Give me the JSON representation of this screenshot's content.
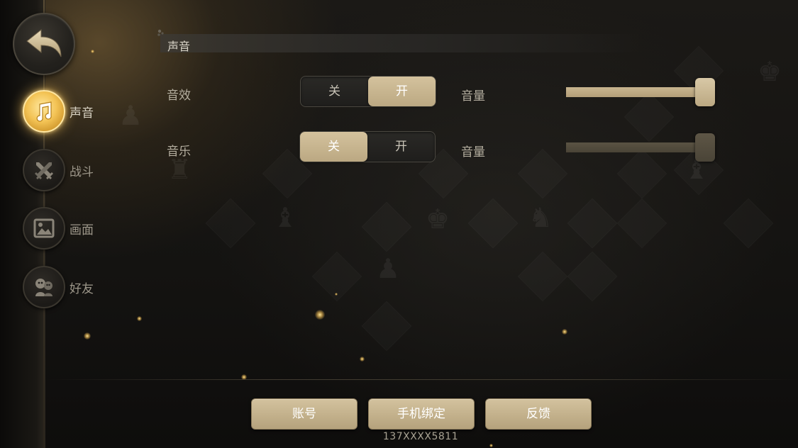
{
  "nav": {
    "back_icon": "back-arrow-icon",
    "items": [
      {
        "label": "声音",
        "icon": "music-note-icon",
        "active": true
      },
      {
        "label": "战斗",
        "icon": "crossed-swords-icon",
        "active": false
      },
      {
        "label": "画面",
        "icon": "picture-icon",
        "active": false
      },
      {
        "label": "好友",
        "icon": "friends-icon",
        "active": false
      }
    ]
  },
  "section": {
    "title": "声音"
  },
  "settings": [
    {
      "label": "音效",
      "toggle_off_label": "关",
      "toggle_on_label": "开",
      "state": "开",
      "volume_label": "音量",
      "volume": 1.0
    },
    {
      "label": "音乐",
      "toggle_off_label": "关",
      "toggle_on_label": "开",
      "state": "关",
      "volume_label": "音量",
      "volume": 1.0
    }
  ],
  "footer": {
    "account_button": "账号",
    "bind_phone_button": "手机绑定",
    "feedback_button": "反馈",
    "phone_number": "137XXXX5811"
  },
  "colors": {
    "accent_gold": "#c9b690",
    "active_glow": "#f3c355"
  }
}
